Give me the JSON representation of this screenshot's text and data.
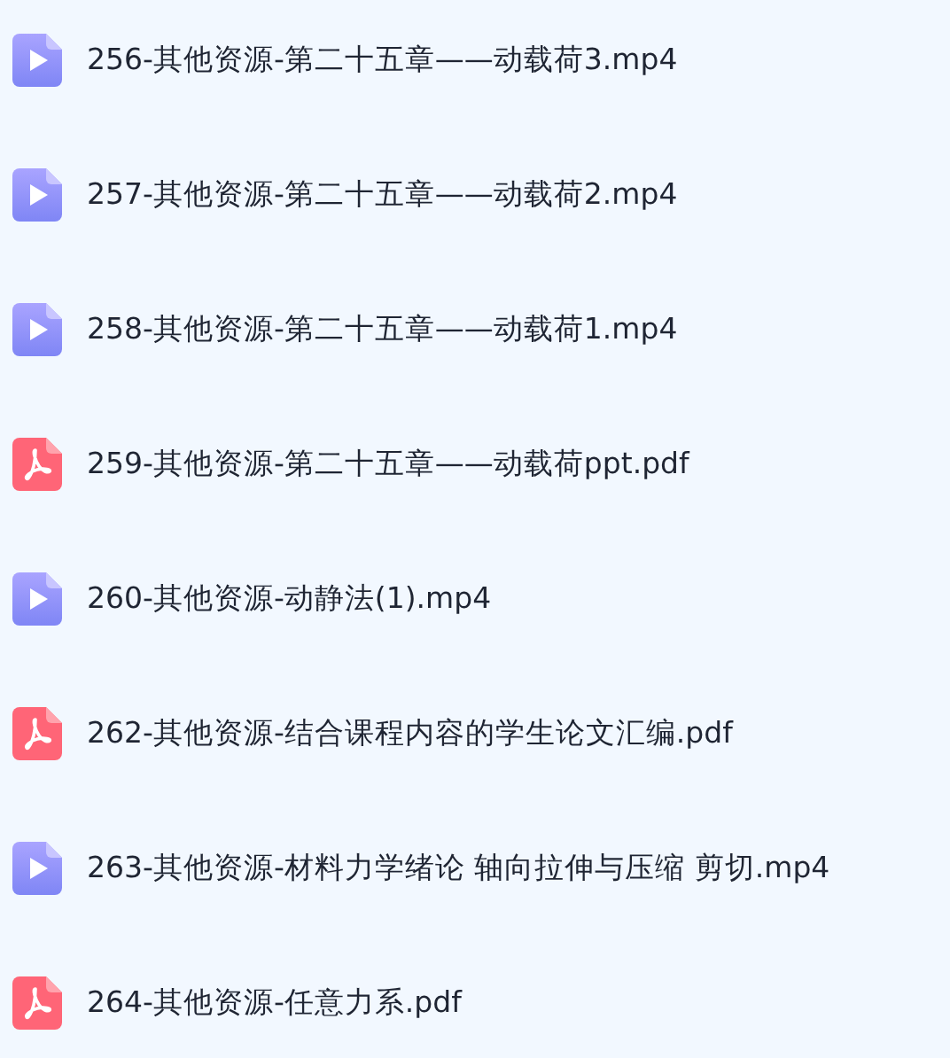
{
  "files": [
    {
      "kind": "video",
      "name": "256-其他资源-第二十五章——动载荷3.mp4"
    },
    {
      "kind": "video",
      "name": "257-其他资源-第二十五章——动载荷2.mp4"
    },
    {
      "kind": "video",
      "name": "258-其他资源-第二十五章——动载荷1.mp4"
    },
    {
      "kind": "pdf",
      "name": "259-其他资源-第二十五章——动载荷ppt.pdf"
    },
    {
      "kind": "video",
      "name": "260-其他资源-动静法(1).mp4"
    },
    {
      "kind": "pdf",
      "name": "262-其他资源-结合课程内容的学生论文汇编.pdf"
    },
    {
      "kind": "video",
      "name": "263-其他资源-材料力学绪论 轴向拉伸与压缩 剪切.mp4"
    },
    {
      "kind": "pdf",
      "name": "264-其他资源-任意力系.pdf"
    }
  ]
}
